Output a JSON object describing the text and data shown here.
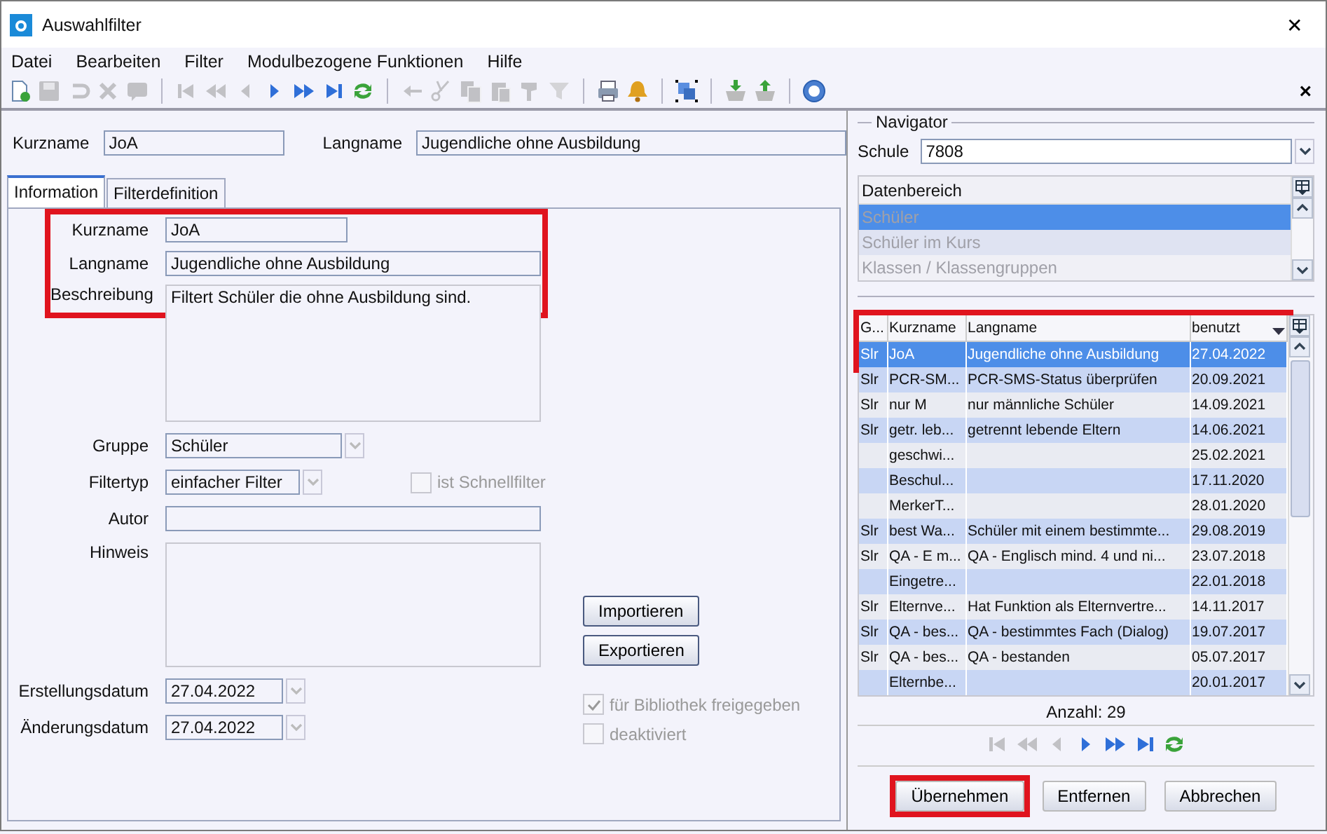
{
  "window": {
    "title": "Auswahlfilter",
    "close": "✕"
  },
  "menu": [
    {
      "label": "Datei"
    },
    {
      "label": "Bearbeiten"
    },
    {
      "label": "Filter"
    },
    {
      "label": "Modulbezogene Funktionen"
    },
    {
      "label": "Hilfe"
    }
  ],
  "toolbar": [
    {
      "kind": "new",
      "disabled": false
    },
    {
      "kind": "save",
      "disabled": true
    },
    {
      "kind": "undo",
      "disabled": true
    },
    {
      "kind": "delete",
      "disabled": true
    },
    {
      "kind": "comment",
      "disabled": true
    },
    {
      "kind": "sep"
    },
    {
      "kind": "first",
      "disabled": true
    },
    {
      "kind": "prev-page",
      "disabled": true
    },
    {
      "kind": "prev",
      "disabled": true
    },
    {
      "kind": "next",
      "disabled": false
    },
    {
      "kind": "next-page",
      "disabled": false
    },
    {
      "kind": "last",
      "disabled": false
    },
    {
      "kind": "refresh",
      "disabled": false
    },
    {
      "kind": "sep"
    },
    {
      "kind": "back",
      "disabled": true
    },
    {
      "kind": "cut",
      "disabled": true
    },
    {
      "kind": "copy",
      "disabled": true
    },
    {
      "kind": "paste",
      "disabled": true
    },
    {
      "kind": "brush",
      "disabled": true
    },
    {
      "kind": "funnel",
      "disabled": true
    },
    {
      "kind": "sep"
    },
    {
      "kind": "print",
      "disabled": false
    },
    {
      "kind": "bell",
      "disabled": false
    },
    {
      "kind": "sep"
    },
    {
      "kind": "select",
      "disabled": false
    },
    {
      "kind": "sep"
    },
    {
      "kind": "import",
      "disabled": false
    },
    {
      "kind": "export",
      "disabled": false
    },
    {
      "kind": "sep"
    },
    {
      "kind": "help",
      "disabled": false
    }
  ],
  "pane_close": "×",
  "header": {
    "kurzname_label": "Kurzname",
    "kurzname": "JoA",
    "langname_label": "Langname",
    "langname": "Jugendliche ohne Ausbildung"
  },
  "tabs": [
    {
      "label": "Information",
      "selected": true
    },
    {
      "label": "Filterdefinition",
      "selected": false
    }
  ],
  "form": {
    "highlighted": true,
    "kurzname_label": "Kurzname",
    "kurzname": "JoA",
    "langname_label": "Langname",
    "langname": "Jugendliche ohne Ausbildung",
    "beschreibung_label": "Beschreibung",
    "beschreibung": "Filtert Schüler die ohne Ausbildung sind.",
    "gruppe_label": "Gruppe",
    "gruppe": "Schüler",
    "filtertyp_label": "Filtertyp",
    "filtertyp": "einfacher Filter",
    "schnellfilter": {
      "label": "ist Schnellfilter",
      "checked": false,
      "disabled": true
    },
    "autor_label": "Autor",
    "hinweis_label": "Hinweis",
    "erstellung_label": "Erstellungsdatum",
    "erstellung": "27.04.2022",
    "aenderung_label": "Änderungsdatum",
    "aenderung": "27.04.2022",
    "buttons": [
      "Importieren",
      "Exportieren"
    ],
    "checks": [
      {
        "label": "für Bibliothek freigegeben",
        "checked": true,
        "disabled": true
      },
      {
        "label": "deaktiviert",
        "checked": false,
        "disabled": true
      }
    ]
  },
  "navigator": {
    "title": "Navigator",
    "schule_label": "Schule",
    "schule": "7808",
    "datenbereich": {
      "header": "Datenbereich",
      "items": [
        {
          "label": "Schüler",
          "selected": true
        },
        {
          "label": "Schüler im Kurs",
          "selected": false
        },
        {
          "label": "Klassen / Klassengruppen",
          "selected": false
        }
      ]
    },
    "table": {
      "highlighted": true,
      "columns": [
        "G...",
        "Kurzname",
        "Langname",
        "benutzt"
      ],
      "rows": [
        {
          "cells": [
            "Slr",
            "JoA",
            "Jugendliche ohne Ausbildung",
            "27.04.2022"
          ],
          "selected": true
        },
        {
          "cells": [
            "Slr",
            "PCR-SM...",
            "PCR-SMS-Status überprüfen",
            "20.09.2021"
          ],
          "selected": false
        },
        {
          "cells": [
            "Slr",
            "nur M",
            "nur männliche Schüler",
            "14.09.2021"
          ],
          "selected": false
        },
        {
          "cells": [
            "Slr",
            "getr. leb...",
            "getrennt lebende Eltern",
            "14.06.2021"
          ],
          "selected": false
        },
        {
          "cells": [
            "",
            "geschwi...",
            "",
            "25.02.2021"
          ],
          "selected": false
        },
        {
          "cells": [
            "",
            "Beschul...",
            "",
            "17.11.2020"
          ],
          "selected": false
        },
        {
          "cells": [
            "",
            "MerkerT...",
            "",
            "28.01.2020"
          ],
          "selected": false
        },
        {
          "cells": [
            "Slr",
            "best Wa...",
            "Schüler mit einem bestimmte...",
            "29.08.2019"
          ],
          "selected": false
        },
        {
          "cells": [
            "Slr",
            "QA - E m...",
            "QA - Englisch mind. 4 und ni...",
            "23.07.2018"
          ],
          "selected": false
        },
        {
          "cells": [
            "",
            "Eingetre...",
            "",
            "22.01.2018"
          ],
          "selected": false
        },
        {
          "cells": [
            "Slr",
            "Elternve...",
            "Hat Funktion als Elternvertre...",
            "14.11.2017"
          ],
          "selected": false
        },
        {
          "cells": [
            "Slr",
            "QA - bes...",
            "QA - bestimmtes Fach (Dialog)",
            "19.07.2017"
          ],
          "selected": false
        },
        {
          "cells": [
            "Slr",
            "QA - bes...",
            "QA - bestanden",
            "05.07.2017"
          ],
          "selected": false
        },
        {
          "cells": [
            "",
            "Elternbe...",
            "",
            "20.01.2017"
          ],
          "selected": false
        }
      ]
    },
    "count": "Anzahl: 29",
    "nav": [
      {
        "kind": "first",
        "disabled": true
      },
      {
        "kind": "prev-page",
        "disabled": true
      },
      {
        "kind": "prev",
        "disabled": true
      },
      {
        "kind": "next",
        "disabled": false
      },
      {
        "kind": "next-page",
        "disabled": false
      },
      {
        "kind": "last",
        "disabled": false
      },
      {
        "kind": "refresh",
        "disabled": false
      }
    ],
    "buttons": [
      {
        "label": "Übernehmen",
        "highlighted": true
      },
      {
        "label": "Entfernen",
        "highlighted": false
      },
      {
        "label": "Abbrechen",
        "highlighted": false
      }
    ]
  }
}
